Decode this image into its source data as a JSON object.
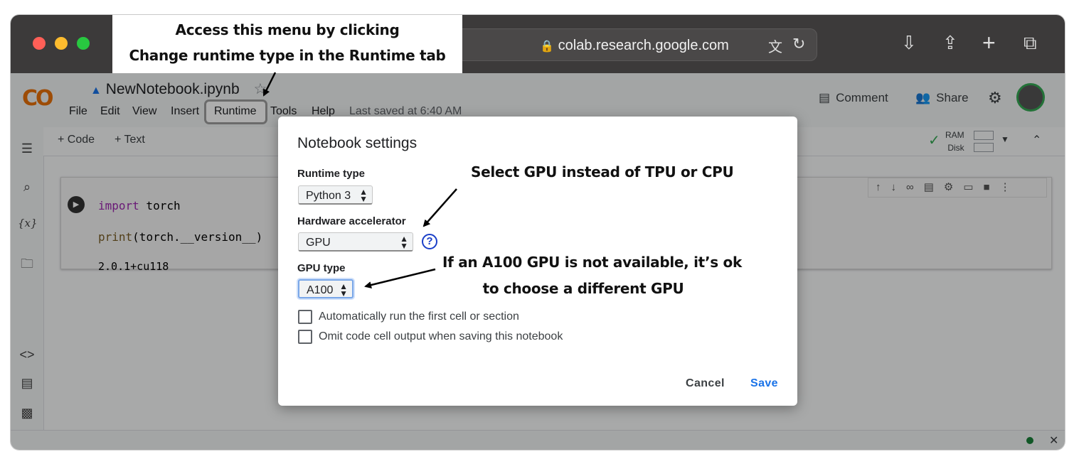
{
  "browser": {
    "url": "colab.research.google.com",
    "icons": [
      "lock-icon",
      "translate-icon",
      "reload-icon",
      "download-icon",
      "share-icon",
      "new-tab-icon",
      "tabs-overview-icon"
    ]
  },
  "callouts": {
    "menu_line1": "Access this menu by clicking",
    "menu_line2": "Change runtime type in the Runtime tab",
    "gpu": "Select GPU instead of TPU or CPU",
    "a100_line1": "If an A100 GPU is not available, it’s ok",
    "a100_line2": "to choose a different GPU"
  },
  "colab": {
    "logo": "CO",
    "notebook_name": "NewNotebook.ipynb",
    "menu": [
      "File",
      "Edit",
      "View",
      "Insert",
      "Runtime",
      "Tools",
      "Help"
    ],
    "last_saved": "Last saved at 6:40 AM",
    "comment": "Comment",
    "share": "Share",
    "toolbar": {
      "code": "+ Code",
      "text": "+ Text"
    },
    "resources": {
      "ram": "RAM",
      "disk": "Disk"
    }
  },
  "cell": {
    "line1_keyword": "import",
    "line1_rest": " torch",
    "line2_func": "print",
    "line2_rest": "(torch.__version__)",
    "output": "2.0.1+cu118"
  },
  "dialog": {
    "title": "Notebook settings",
    "runtime_label": "Runtime type",
    "runtime_value": "Python 3",
    "hardware_label": "Hardware accelerator",
    "hardware_value": "GPU",
    "help": "?",
    "gpu_type_label": "GPU type",
    "gpu_type_value": "A100",
    "check1": "Automatically run the first cell or section",
    "check2": "Omit code cell output when saving this notebook",
    "cancel": "Cancel",
    "save": "Save"
  },
  "colors": {
    "accent_blue": "#1a73e8",
    "logo_orange": "#e8710a",
    "keyword_purple": "#9c27b0",
    "title_bar": "#3c3a3a"
  }
}
